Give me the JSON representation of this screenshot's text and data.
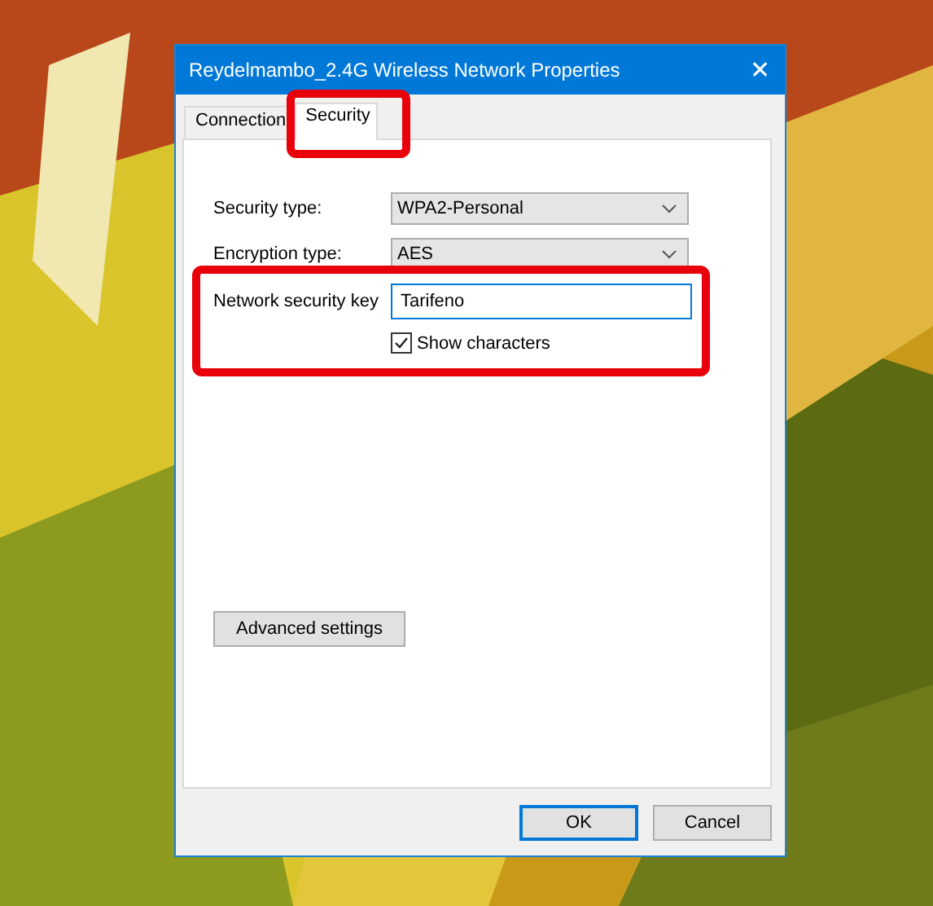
{
  "window": {
    "title": "Reydelmambo_2.4G Wireless Network Properties",
    "close": "✕"
  },
  "tabs": [
    {
      "label": "Connection",
      "selected": false
    },
    {
      "label": "Security",
      "selected": true
    }
  ],
  "fields": [
    {
      "kind": "dropdown",
      "label": "Security type:",
      "value": "WPA2-Personal"
    },
    {
      "kind": "dropdown",
      "label": "Encryption type:",
      "value": "AES"
    },
    {
      "kind": "text",
      "label": "Network security key",
      "value": "Tarifeno"
    }
  ],
  "show_characters": {
    "label": "Show characters",
    "checked": true
  },
  "advanced_button": "Advanced settings",
  "buttons": [
    {
      "label": "OK",
      "default": true
    },
    {
      "label": "Cancel",
      "default": false
    }
  ]
}
